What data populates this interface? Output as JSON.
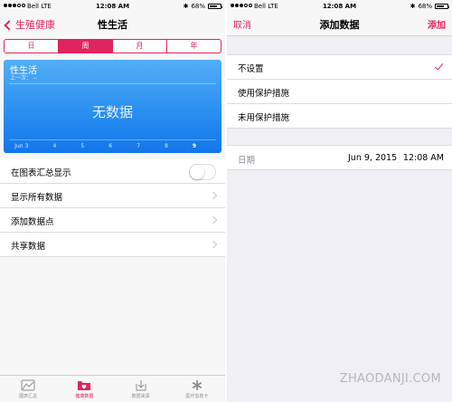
{
  "left": {
    "status": {
      "carrier": "Bell  LTE",
      "time": "12:08 AM",
      "battery": "68%"
    },
    "nav": {
      "back_label": "生殖健康",
      "title": "性生活"
    },
    "segments": [
      {
        "label": "日",
        "active": false
      },
      {
        "label": "周",
        "active": true
      },
      {
        "label": "月",
        "active": false
      },
      {
        "label": "年",
        "active": false
      }
    ],
    "chart": {
      "title": "性生活",
      "subtitle": "上一次： --",
      "no_data": "无数据",
      "axis": [
        "Jun 3",
        "4",
        "5",
        "6",
        "7",
        "8",
        "9"
      ]
    },
    "rows": [
      {
        "label": "在图表汇总显示",
        "control": "toggle",
        "toggle_on": false
      },
      {
        "label": "显示所有数据",
        "control": "chevron"
      },
      {
        "label": "添加数据点",
        "control": "chevron"
      },
      {
        "label": "共享数据",
        "control": "chevron"
      }
    ],
    "tabs": [
      {
        "label": "图表汇总",
        "icon": "dashboard-icon",
        "active": false
      },
      {
        "label": "健康数据",
        "icon": "health-data-icon",
        "active": true
      },
      {
        "label": "数据来源",
        "icon": "sources-icon",
        "active": false
      },
      {
        "label": "医疗急救卡",
        "icon": "medical-id-icon",
        "active": false
      }
    ]
  },
  "right": {
    "status": {
      "carrier": "Bell  LTE",
      "time": "12:08 AM",
      "battery": "68%"
    },
    "nav": {
      "cancel_label": "取消",
      "title": "添加数据",
      "add_label": "添加"
    },
    "options": [
      {
        "label": "不设置",
        "selected": true
      },
      {
        "label": "使用保护措施",
        "selected": false
      },
      {
        "label": "未用保护措施",
        "selected": false
      }
    ],
    "date": {
      "label": "日期",
      "date_value": "Jun 9, 2015",
      "time_value": "12:08 AM"
    }
  },
  "watermark": "ZHAODANJI.COM",
  "colors": {
    "accent": "#e0245e",
    "chart_top": "#54aef7",
    "chart_bottom": "#1376ea"
  }
}
